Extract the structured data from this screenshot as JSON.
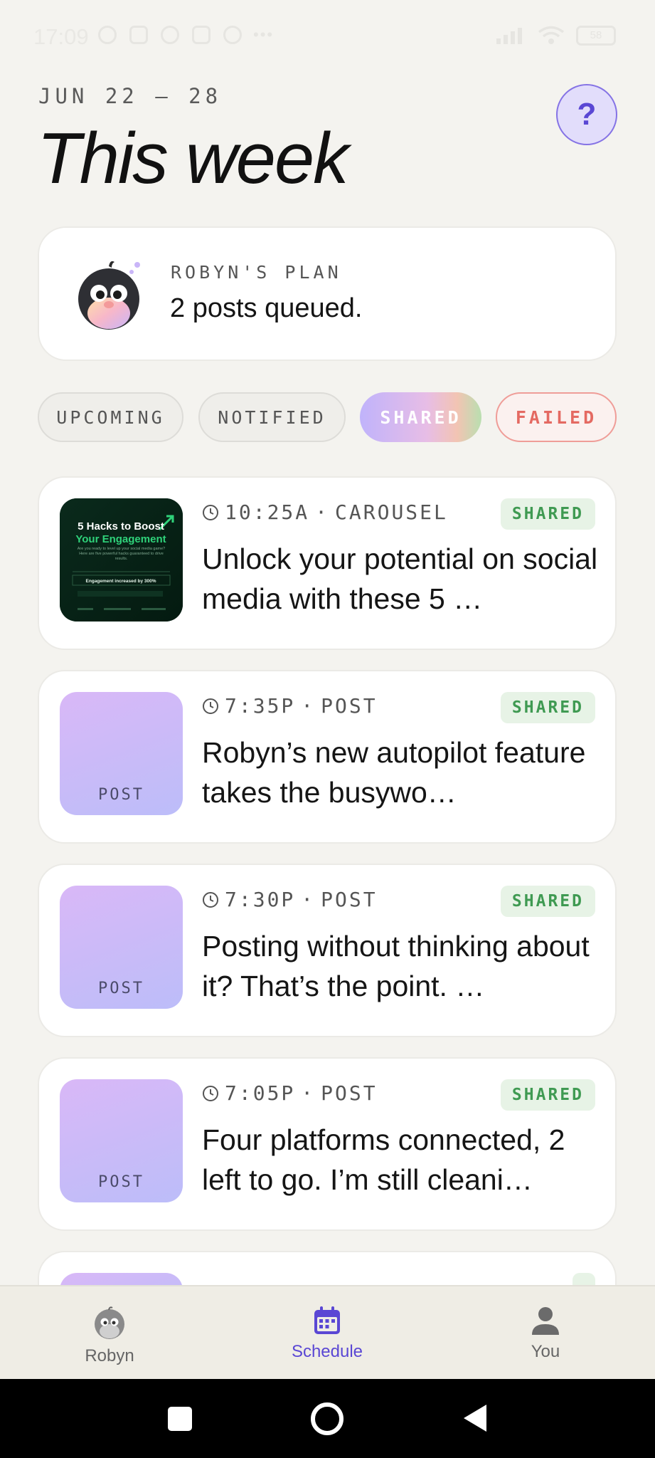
{
  "status_bar": {
    "time": "17:09",
    "battery": "58"
  },
  "header": {
    "date_range": "JUN 22 — 28",
    "title": "This week",
    "help_label": "?"
  },
  "plan": {
    "label": "ROBYN'S PLAN",
    "text": "2 posts queued."
  },
  "filters": {
    "upcoming": "UPCOMING",
    "notified": "NOTIFIED",
    "shared": "SHARED",
    "failed": "FAILED"
  },
  "posts": [
    {
      "time": "10:25A",
      "type": "CAROUSEL",
      "status": "SHARED",
      "text": "Unlock your potential on social media with these 5 …",
      "thumb": {
        "title_1": "5 Hacks to Boost",
        "title_2": "Your Engagement",
        "body": "Are you ready to level up your social media game? Here are five powerful hacks guaranteed to drive results.",
        "stat": "Engagement increased by 300%"
      }
    },
    {
      "time": "7:35P",
      "type": "POST",
      "status": "SHARED",
      "thumb_label": "POST",
      "text": "Robyn’s new autopilot feature takes the busywo…"
    },
    {
      "time": "7:30P",
      "type": "POST",
      "status": "SHARED",
      "thumb_label": "POST",
      "text": "Posting without thinking about it? That’s the point. …"
    },
    {
      "time": "7:05P",
      "type": "POST",
      "status": "SHARED",
      "thumb_label": "POST",
      "text": "Four platforms connected, 2 left to go. I’m still cleani…"
    }
  ],
  "nav": {
    "robyn": "Robyn",
    "schedule": "Schedule",
    "you": "You"
  },
  "colors": {
    "accent": "#5a47d4",
    "shared_badge": "#3f9a52",
    "failed": "#e46a62",
    "background": "#f4f3ef"
  },
  "icons": {
    "help": "question-icon",
    "clock": "clock-icon",
    "schedule": "calendar-icon",
    "you": "person-icon",
    "robyn": "robyn-avatar-icon"
  }
}
